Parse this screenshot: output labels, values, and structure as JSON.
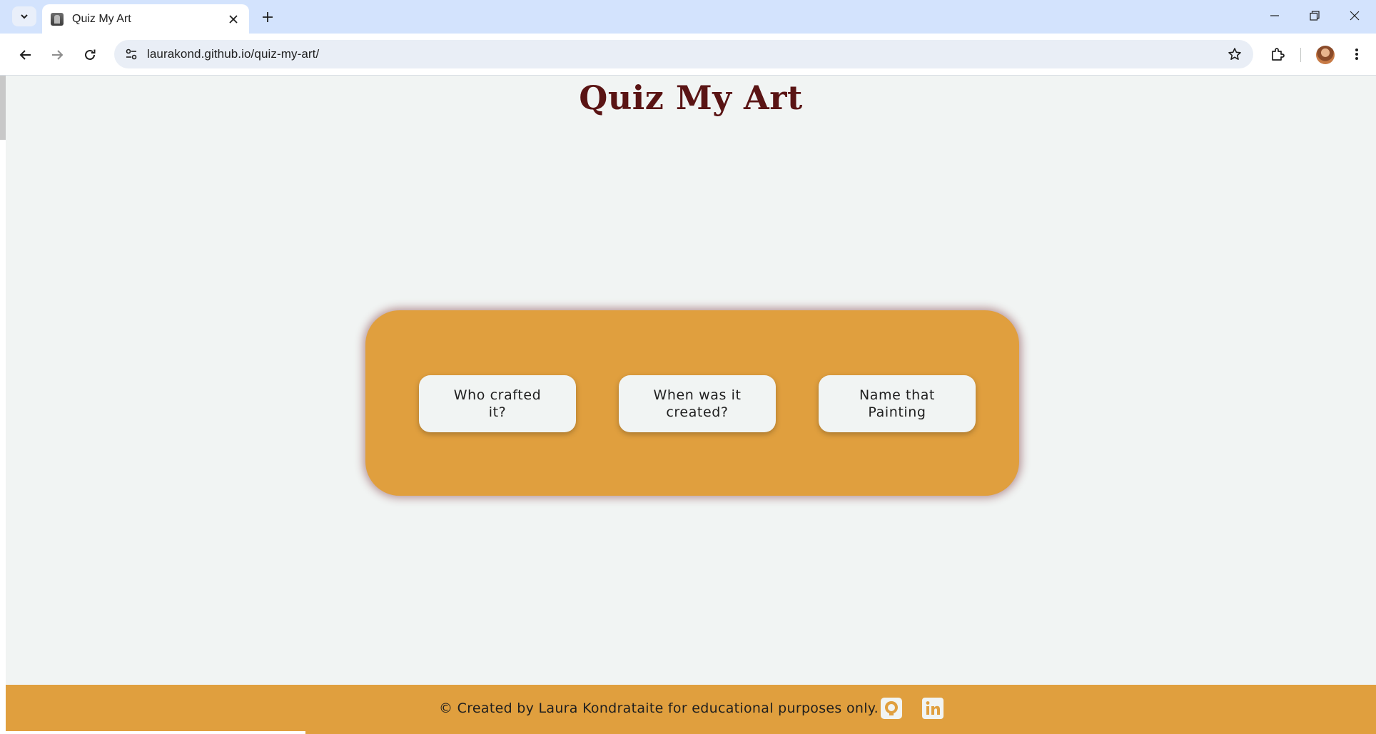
{
  "browser": {
    "tab_title": "Quiz My Art",
    "url": "laurakond.github.io/quiz-my-art/"
  },
  "page": {
    "title": "Quiz My Art",
    "quiz_options": [
      "Who crafted it?",
      "When was it created?",
      "Name that Painting"
    ]
  },
  "footer": {
    "text": "© Created by Laura Kondrataite for educational purposes only.",
    "icons": [
      "github-icon",
      "linkedin-icon"
    ]
  },
  "colors": {
    "accent": "#e09f3e",
    "title": "#5a1414",
    "background": "#f1f4f3"
  }
}
